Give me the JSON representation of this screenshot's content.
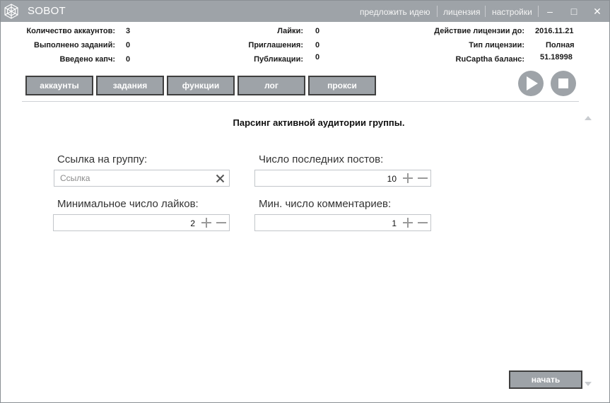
{
  "window": {
    "title": "SOBOT",
    "links": [
      "предложить идею",
      "лицензия",
      "настройки"
    ],
    "controls": {
      "minimize": "–",
      "maximize": "□",
      "close": "✕"
    }
  },
  "stats": {
    "accounts_label": "Количество аккаунтов:",
    "accounts_value": "3",
    "tasks_label": "Выполнено заданий:",
    "tasks_value": "0",
    "captcha_label": "Введено капч:",
    "captcha_value": "0",
    "likes_label": "Лайки:",
    "likes_value": "0",
    "invites_label": "Приглашения:",
    "invites_value": "0",
    "posts_label": "Публикации:",
    "posts_value": "0",
    "license_until_label": "Действие лицензии до:",
    "license_until_value": "2016.11.21",
    "license_type_label": "Тип лицензии:",
    "license_type_value": "Полная",
    "rucaptcha_label": "RuCaptha баланс:",
    "rucaptcha_value": "51.18998"
  },
  "tabs": [
    "аккаунты",
    "задания",
    "функции",
    "лог",
    "прокси"
  ],
  "main": {
    "section_title": "Парсинг активной аудитории группы.",
    "group_link_label": "Ссылка на группу:",
    "group_link_placeholder": "Ссылка",
    "last_posts_label": "Число последних постов:",
    "last_posts_value": "10",
    "min_likes_label": "Минимальное число лайков:",
    "min_likes_value": "2",
    "min_comments_label": "Мин. число комментариев:",
    "min_comments_value": "1",
    "start_label": "начать"
  },
  "icons": {
    "logo": "spider-web-icon",
    "play": "play-icon",
    "stop": "stop-icon",
    "clear": "close-icon",
    "plus": "plus-icon",
    "minus": "minus-icon"
  },
  "colors": {
    "accent": "#9ea3a8",
    "button_border": "#3f3f3f"
  }
}
